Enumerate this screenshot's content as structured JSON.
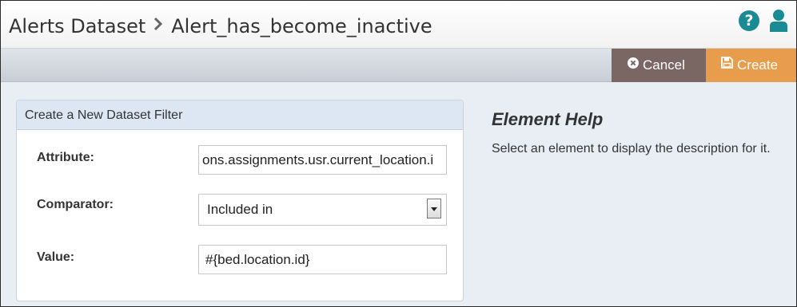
{
  "header": {
    "breadcrumb_parent": "Alerts Dataset",
    "breadcrumb_separator": "›",
    "breadcrumb_current": "Alert_has_become_inactive",
    "help_icon": "question-circle-icon",
    "user_icon": "user-icon",
    "help_glyph": "?"
  },
  "toolbar": {
    "cancel_label": "Cancel",
    "cancel_icon": "times-circle-icon",
    "create_label": "Create",
    "create_icon": "floppy-disk-icon"
  },
  "form": {
    "title": "Create a New Dataset Filter",
    "attribute_label": "Attribute:",
    "attribute_value": "ons.assignments.usr.current_location.i",
    "comparator_label": "Comparator:",
    "comparator_value": "Included in",
    "value_label": "Value:",
    "value_value": "#{bed.location.id}"
  },
  "help": {
    "title": "Element Help",
    "text": "Select an element to display the description for it."
  },
  "colors": {
    "cancel_bg": "#7a6663",
    "create_bg": "#e89d4d",
    "accent_icon": "#1a8a94",
    "panel_header_bg": "#dde7f3",
    "page_bg": "#e9eef5"
  }
}
